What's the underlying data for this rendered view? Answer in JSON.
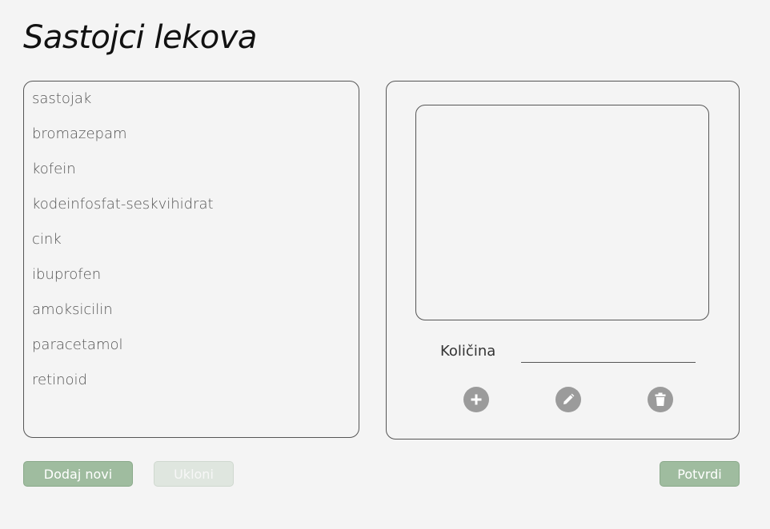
{
  "page": {
    "title": "Sastojci lekova"
  },
  "ingredients": {
    "items": [
      "sastojak",
      "bromazepam",
      "kofein",
      "kodeinfosfat-seskvihidrat",
      "cink",
      "ibuprofen",
      "amoksicilin",
      "paracetamol",
      "retinoid"
    ]
  },
  "detail": {
    "quantity_label": "Količina",
    "quantity_value": "",
    "icons": {
      "add": "plus-circle-icon",
      "edit": "pencil-icon",
      "delete": "trash-icon"
    }
  },
  "actions": {
    "add_new_label": "Dodaj novi",
    "remove_label": "Ukloni",
    "confirm_label": "Potvrdi"
  },
  "colors": {
    "background": "#f4f4f4",
    "button_primary": "#9fbc9f",
    "button_disabled": "#dfe6df",
    "icon_gray": "#9b9b9b"
  }
}
